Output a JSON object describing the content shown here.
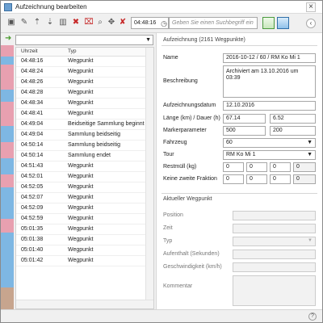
{
  "window": {
    "title": "Aufzeichnung bearbeiten",
    "close": "×",
    "collapse": "‹"
  },
  "toolbar": {
    "time_value": "04:48:16",
    "search_placeholder": "Geben Sie einen Suchbegriff ein",
    "icons": [
      "save-icon",
      "edit-icon",
      "export-icon",
      "import-icon",
      "trash-icon",
      "delete-red-icon",
      "delete-grid-icon",
      "magnifier-icon",
      "move-icon",
      "delete-point-icon",
      "clock-icon"
    ]
  },
  "grid": {
    "headers": {
      "time": "Uhrzeit",
      "type": "Typ"
    },
    "rows": [
      {
        "time": "04:48:16",
        "type": "Wegpunkt"
      },
      {
        "time": "04:48:24",
        "type": "Wegpunkt"
      },
      {
        "time": "04:48:26",
        "type": "Wegpunkt"
      },
      {
        "time": "04:48:28",
        "type": "Wegpunkt"
      },
      {
        "time": "04:48:34",
        "type": "Wegpunkt"
      },
      {
        "time": "04:48:41",
        "type": "Wegpunkt"
      },
      {
        "time": "04:49:04",
        "type": "Beidseitige Sammlung beginnt"
      },
      {
        "time": "04:49:04",
        "type": "Sammlung beidseitig"
      },
      {
        "time": "04:50:14",
        "type": "Sammlung beidseitig"
      },
      {
        "time": "04:50:14",
        "type": "Sammlung endet"
      },
      {
        "time": "04:51:43",
        "type": "Wegpunkt"
      },
      {
        "time": "04:52:01",
        "type": "Wegpunkt"
      },
      {
        "time": "04:52:05",
        "type": "Wegpunkt"
      },
      {
        "time": "04:52:07",
        "type": "Wegpunkt"
      },
      {
        "time": "04:52:09",
        "type": "Wegpunkt"
      },
      {
        "time": "04:52:59",
        "type": "Wegpunkt"
      },
      {
        "time": "05:01:35",
        "type": "Wegpunkt"
      },
      {
        "time": "05:01:38",
        "type": "Wegpunkt"
      },
      {
        "time": "05:01:40",
        "type": "Wegpunkt"
      },
      {
        "time": "05:01:42",
        "type": "Wegpunkt"
      }
    ]
  },
  "details": {
    "header": "Aufzeichnung",
    "count": "(2161 Wegpunkte)",
    "name_label": "Name",
    "name_value": "2016-10-12 / 60 / RM Ko Mi 1",
    "description_label": "Beschreibung",
    "description_value": "Archiviert am 13.10.2016 um 03:39",
    "date_label": "Aufzeichnungsdatum",
    "date_value": "12.10.2016",
    "length_label": "Länge (km) / Dauer (h)",
    "length_value": "67.14",
    "duration_value": "6.52",
    "marker_label": "Markerparameter",
    "marker_a": "500",
    "marker_b": "200",
    "vehicle_label": "Fahrzeug",
    "vehicle_value": "60",
    "tour_label": "Tour",
    "tour_value": "RM Ko Mi 1",
    "waste_label": "Restmüll (kg)",
    "waste_values": [
      "0",
      "0",
      "0",
      "0"
    ],
    "fraction_label": "Keine zweite Fraktion",
    "fraction_values": [
      "0",
      "0",
      "0",
      "0"
    ]
  },
  "waypoint": {
    "header": "Aktueller Wegpunkt",
    "position_label": "Position",
    "time_label": "Zeit",
    "type_label": "Typ",
    "stay_label": "Aufenthalt (Sekunden)",
    "speed_label": "Geschwindigkeit (km/h)",
    "comment_label": "Kommentar"
  },
  "status": {
    "help": "?"
  },
  "colors": {
    "stripe_pink": "#e8a0b0",
    "stripe_blue": "#7eb7e3",
    "stripe_brown": "#c7a58e",
    "accent_green": "#4a9b2f"
  }
}
